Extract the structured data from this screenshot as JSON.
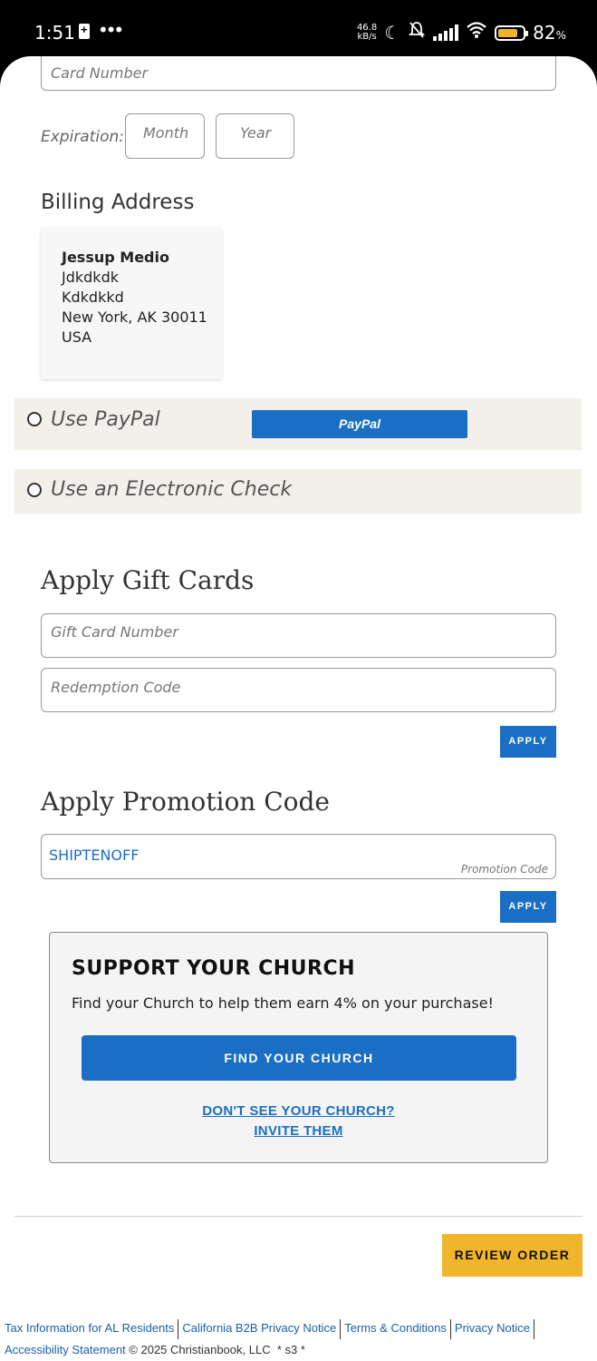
{
  "status_bar": {
    "time": "1:51",
    "dots": "•••",
    "speed_value": "46.8",
    "speed_unit": "kB/s",
    "battery_pct": "82",
    "battery_pct_suffix": "%"
  },
  "card": {
    "number_placeholder": "Card Number",
    "expiration_label": "Expiration:",
    "month_placeholder": "Month",
    "year_placeholder": "Year"
  },
  "billing": {
    "heading": "Billing Address",
    "name": "Jessup Medio",
    "line1": "Jdkdkdk",
    "line2": "Kdkdkkd",
    "city_line": "New York, AK 30011",
    "country": "USA"
  },
  "payment_options": {
    "paypal_label": "Use PayPal",
    "paypal_button": "PayPal",
    "echeck_label": "Use an Electronic Check"
  },
  "gift_cards": {
    "heading": "Apply Gift Cards",
    "number_placeholder": "Gift Card Number",
    "redemption_placeholder": "Redemption Code",
    "apply_label": "APPLY"
  },
  "promotion": {
    "heading": "Apply Promotion Code",
    "code_value": "SHIPTENOFF",
    "field_label": "Promotion Code",
    "apply_label": "APPLY"
  },
  "church": {
    "heading": "SUPPORT YOUR CHURCH",
    "description": "Find your Church to help them earn 4% on your purchase!",
    "find_button": "FIND YOUR CHURCH",
    "invite_line1": "DON'T SEE YOUR CHURCH?",
    "invite_line2": "INVITE THEM"
  },
  "review_button": "REVIEW ORDER",
  "footer": {
    "links": [
      "Tax Information for AL Residents",
      "California B2B Privacy Notice",
      "Terms & Conditions",
      "Privacy Notice",
      "Accessibility Statement"
    ],
    "copyright": "© 2025 Christianbook, LLC",
    "server_tag": "* s3 *"
  }
}
